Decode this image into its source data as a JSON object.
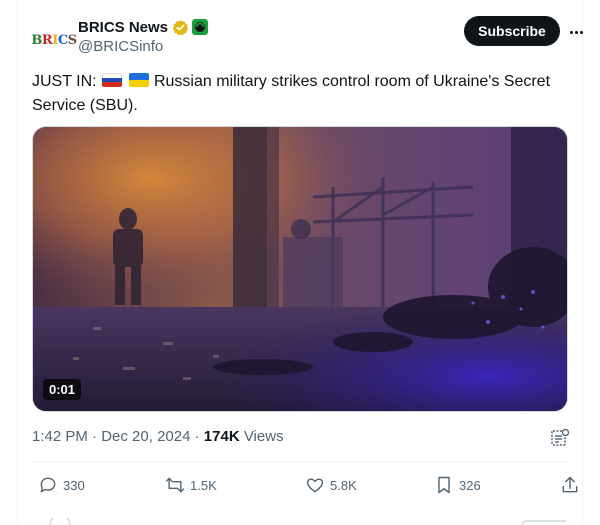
{
  "account": {
    "display_name": "BRICS News",
    "handle": "@BRICSinfo",
    "avatar_text": [
      "B",
      "R",
      "I",
      "C",
      "S"
    ]
  },
  "header": {
    "subscribe_label": "Subscribe"
  },
  "tweet": {
    "text_before": "JUST IN: ",
    "text_after": " Russian military strikes control room of Ukraine's Secret Service (SBU)."
  },
  "media": {
    "duration": "0:01"
  },
  "meta": {
    "time": "1:42 PM",
    "dot": " · ",
    "date": "Dec 20, 2024",
    "views_count": "174K",
    "views_label": " Views"
  },
  "actions": {
    "replies": "330",
    "reposts": "1.5K",
    "likes": "5.8K",
    "bookmarks": "326"
  },
  "colors": {
    "accent": "#0f1419",
    "muted": "#536471",
    "verified_gold": "#e2b719",
    "affiliate_green": "#1d9e3a"
  }
}
